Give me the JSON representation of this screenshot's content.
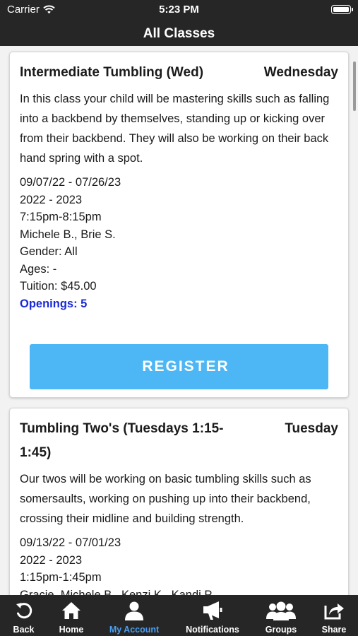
{
  "status_bar": {
    "carrier": "Carrier",
    "time": "5:23 PM"
  },
  "nav": {
    "title": "All Classes"
  },
  "classes": [
    {
      "name": "Intermediate Tumbling (Wed)",
      "day": "Wednesday",
      "description": "In this class your child will be mastering skills such as falling into a backbend by themselves, standing up or kicking over from their backbend. They will also be working on their back hand spring with a spot.",
      "dates": "09/07/22 - 07/26/23",
      "season": "2022 - 2023",
      "time": "7:15pm-8:15pm",
      "instructors": "Michele B., Brie S.",
      "gender": "Gender: All",
      "ages": "Ages: -",
      "tuition": "Tuition: $45.00",
      "openings": "Openings: 5",
      "register_label": "REGISTER"
    },
    {
      "name": "Tumbling Two's (Tuesdays 1:15-1:45)",
      "day": "Tuesday",
      "description": "Our twos will be working on basic tumbling skills such as somersaults, working on pushing up into their backbend, crossing their midline and building strength.",
      "dates": "09/13/22 - 07/01/23",
      "season": "2022 - 2023",
      "time": "1:15pm-1:45pm",
      "instructors": "Gracie, Michele B., Kenzi K., Kandi P."
    }
  ],
  "tabs": [
    {
      "label": "Back",
      "icon": "back-arrow-icon"
    },
    {
      "label": "Home",
      "icon": "home-icon"
    },
    {
      "label": "My Account",
      "icon": "user-icon"
    },
    {
      "label": "Notifications",
      "icon": "megaphone-icon"
    },
    {
      "label": "Groups",
      "icon": "group-icon"
    },
    {
      "label": "Share",
      "icon": "share-icon"
    }
  ],
  "colors": {
    "bar_background": "#262626",
    "register_button": "#4db6f4",
    "openings_text": "#1a2ad6",
    "active_tab": "#4a9ef0"
  }
}
